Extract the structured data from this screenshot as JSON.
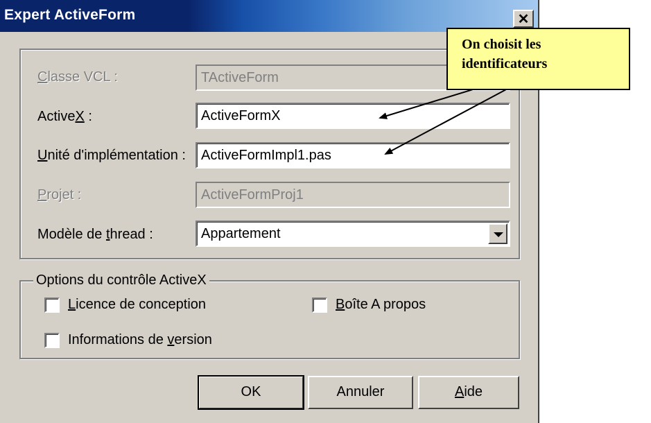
{
  "window": {
    "title": "Expert ActiveForm",
    "close_glyph": "✕"
  },
  "form": {
    "classe_vcl": {
      "label_pre": "",
      "label_key": "C",
      "label_post": "lasse VCL :",
      "value": "TActiveForm",
      "disabled": true
    },
    "activex": {
      "label_pre": "Active",
      "label_key": "X",
      "label_post": " :",
      "value": "ActiveFormX"
    },
    "unite": {
      "label_pre": "",
      "label_key": "U",
      "label_post": "nité d'implémentation :",
      "value": "ActiveFormImpl1.pas"
    },
    "projet": {
      "label_pre": "",
      "label_key": "P",
      "label_post": "rojet :",
      "value": "ActiveFormProj1",
      "disabled": true
    },
    "thread": {
      "label_pre": "Modèle de ",
      "label_key": "t",
      "label_post": "hread :",
      "value": "Appartement"
    }
  },
  "options": {
    "legend": "Options du contrôle ActiveX",
    "licence": {
      "label_key": "L",
      "label_post": "icence de conception",
      "checked": false
    },
    "boite": {
      "label_key": "B",
      "label_post": "oîte A propos",
      "checked": false
    },
    "version": {
      "label_pre": "Informations de ",
      "label_key": "v",
      "label_post": "ersion",
      "checked": false
    }
  },
  "buttons": {
    "ok": "OK",
    "annuler": "Annuler",
    "aide_key": "A",
    "aide_post": "ide"
  },
  "callout": {
    "line1": "On choisit les",
    "line2": "identificateurs"
  }
}
